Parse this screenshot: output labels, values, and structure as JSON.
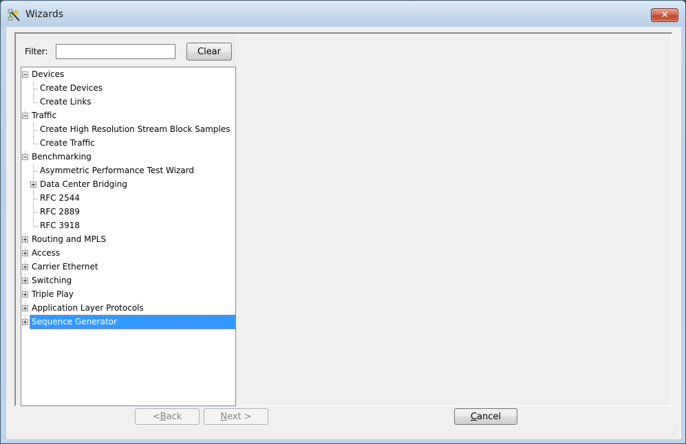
{
  "window": {
    "title": "Wizards",
    "title_icon": "wizard-wand-icon",
    "close_icon": "close-icon"
  },
  "filter": {
    "label": "Filter:",
    "value": "",
    "placeholder": "",
    "clear_label": "Clear"
  },
  "tree": {
    "selected": "Sequence Generator",
    "items": [
      {
        "label": "Devices",
        "level": 0,
        "expander": "minus"
      },
      {
        "label": "Create Devices",
        "level": 1,
        "expander": null
      },
      {
        "label": "Create Links",
        "level": 1,
        "expander": null
      },
      {
        "label": "Traffic",
        "level": 0,
        "expander": "minus"
      },
      {
        "label": "Create High Resolution Stream Block Samples",
        "level": 1,
        "expander": null
      },
      {
        "label": "Create Traffic",
        "level": 1,
        "expander": null
      },
      {
        "label": "Benchmarking",
        "level": 0,
        "expander": "minus"
      },
      {
        "label": "Asymmetric Performance Test Wizard",
        "level": 1,
        "expander": null
      },
      {
        "label": "Data Center Bridging",
        "level": 1,
        "expander": "plus"
      },
      {
        "label": "RFC 2544",
        "level": 1,
        "expander": null
      },
      {
        "label": "RFC 2889",
        "level": 1,
        "expander": null
      },
      {
        "label": "RFC 3918",
        "level": 1,
        "expander": null
      },
      {
        "label": "Routing and MPLS",
        "level": 0,
        "expander": "plus"
      },
      {
        "label": "Access",
        "level": 0,
        "expander": "plus"
      },
      {
        "label": "Carrier Ethernet",
        "level": 0,
        "expander": "plus"
      },
      {
        "label": "Switching",
        "level": 0,
        "expander": "plus"
      },
      {
        "label": "Triple Play",
        "level": 0,
        "expander": "plus"
      },
      {
        "label": "Application Layer Protocols",
        "level": 0,
        "expander": "plus"
      },
      {
        "label": "Sequence Generator",
        "level": 0,
        "expander": "plus"
      }
    ]
  },
  "buttons": {
    "back": {
      "prefix": "< ",
      "mnemonic": "B",
      "rest": "ack",
      "enabled": false
    },
    "next": {
      "prefix": "",
      "mnemonic": "N",
      "rest": "ext >",
      "enabled": false
    },
    "cancel": {
      "prefix": "",
      "mnemonic": "C",
      "rest": "ancel",
      "enabled": true
    }
  },
  "colors": {
    "selection": "#3399ff",
    "close_button": "#c94a33",
    "frame": "#b9d1ea"
  }
}
